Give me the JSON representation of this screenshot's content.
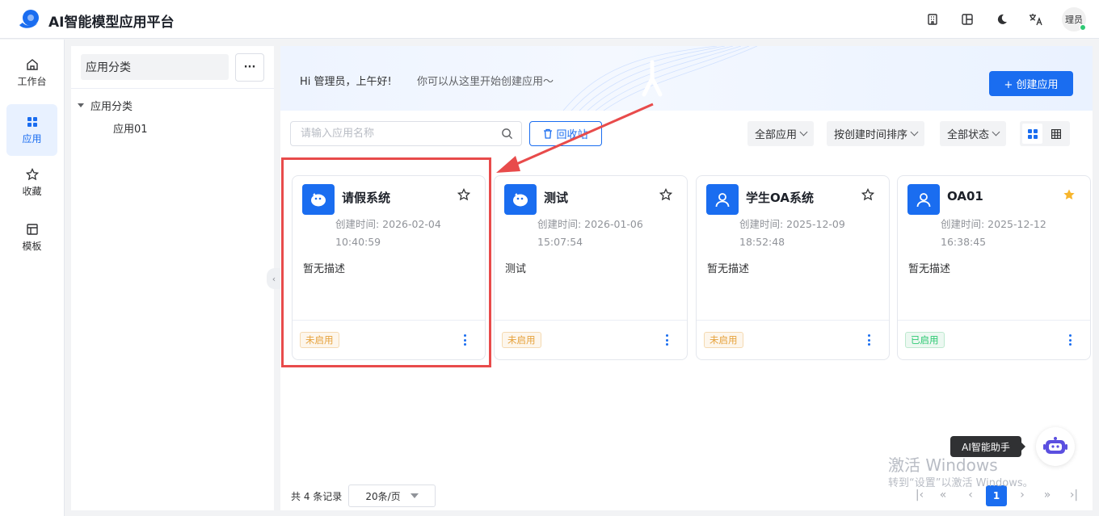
{
  "header": {
    "title": "AI智能模型应用平台",
    "user_label": "理员",
    "icons": [
      "building-icon",
      "layout-icon",
      "moon-icon",
      "translate-icon"
    ]
  },
  "nav": {
    "items": [
      {
        "label": "工作台",
        "icon": "home-icon"
      },
      {
        "label": "应用",
        "icon": "grid-icon",
        "active": true
      },
      {
        "label": "收藏",
        "icon": "star-icon"
      },
      {
        "label": "模板",
        "icon": "template-icon"
      }
    ]
  },
  "category": {
    "title": "应用分类",
    "more_label": "···",
    "tree_root": "应用分类",
    "tree_child": "应用01"
  },
  "banner": {
    "greeting": "Hi 管理员，上午好!",
    "subtitle": "你可以从这里开始创建应用～",
    "create_label": "+ 创建应用"
  },
  "toolbar": {
    "search_placeholder": "请输入应用名称",
    "recycle_label": "回收站",
    "filter_app": "全部应用",
    "sort": "按创建时间排序",
    "filter_status": "全部状态"
  },
  "cards": [
    {
      "name": "请假系统",
      "time_label": "创建时间: 2026-02-04",
      "time_clock": "10:40:59",
      "desc": "暂无描述",
      "status": "未启用",
      "enabled": false,
      "icon": "bot-icon",
      "starred": false
    },
    {
      "name": "测试",
      "time_label": "创建时间: 2026-01-06",
      "time_clock": "15:07:54",
      "desc": "测试",
      "status": "未启用",
      "enabled": false,
      "icon": "bot-icon",
      "starred": false
    },
    {
      "name": "学生OA系统",
      "time_label": "创建时间: 2025-12-09",
      "time_clock": "18:52:48",
      "desc": "暂无描述",
      "status": "未启用",
      "enabled": false,
      "icon": "user-icon",
      "starred": false
    },
    {
      "name": "OA01",
      "time_label": "创建时间: 2025-12-12",
      "time_clock": "16:38:45",
      "desc": "暂无描述",
      "status": "已启用",
      "enabled": true,
      "icon": "user-icon",
      "starred": true
    }
  ],
  "pagination": {
    "total": "共 4 条记录",
    "page_size": "20条/页",
    "current": "1"
  },
  "watermark": {
    "line1": "激活 Windows",
    "line2": "转到“设置”以激活 Windows。"
  },
  "assistant": {
    "tooltip": "AI智能助手"
  },
  "colors": {
    "primary": "#1a6df0",
    "enabled": "#2ec973",
    "disabled": "#e6a23c",
    "highlight": "#e84b4b",
    "star_filled": "#f7b52c"
  }
}
